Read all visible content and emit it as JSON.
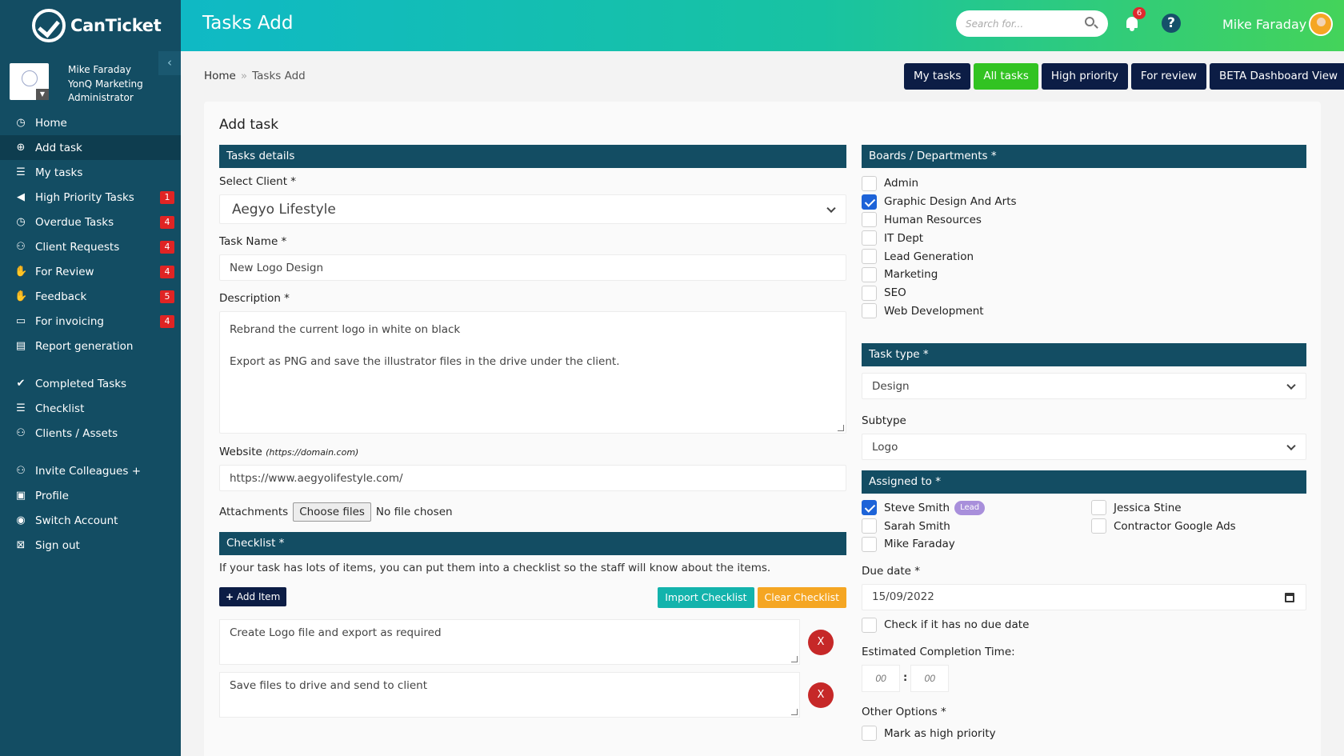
{
  "brand": {
    "name": "CanTicket"
  },
  "profile": {
    "name": "Mike Faraday",
    "company": "YonQ Marketing",
    "role": "Administrator"
  },
  "nav": [
    {
      "label": "Home",
      "icon": "clock-icon",
      "badge": ""
    },
    {
      "label": "Add task",
      "icon": "plus-circle-icon",
      "badge": "",
      "active": true
    },
    {
      "label": "My tasks",
      "icon": "list-icon",
      "badge": ""
    },
    {
      "label": "High Priority Tasks",
      "icon": "megaphone-icon",
      "badge": "1"
    },
    {
      "label": "Overdue Tasks",
      "icon": "clock-icon",
      "badge": "4"
    },
    {
      "label": "Client Requests",
      "icon": "users-icon",
      "badge": "4"
    },
    {
      "label": "For Review",
      "icon": "thumbs-up-icon",
      "badge": "4"
    },
    {
      "label": "Feedback",
      "icon": "thumbs-up-icon",
      "badge": "5"
    },
    {
      "label": "For invoicing",
      "icon": "credit-card-icon",
      "badge": "4"
    },
    {
      "label": "Report generation",
      "icon": "newspaper-icon",
      "badge": ""
    },
    {
      "label": "Completed Tasks",
      "icon": "check-circle-icon",
      "badge": ""
    },
    {
      "label": "Checklist",
      "icon": "list-icon",
      "badge": ""
    },
    {
      "label": "Clients / Assets",
      "icon": "users-icon",
      "badge": ""
    },
    {
      "label": "Invite Colleagues +",
      "icon": "users-icon",
      "badge": ""
    },
    {
      "label": "Profile",
      "icon": "id-card-icon",
      "badge": ""
    },
    {
      "label": "Switch Account",
      "icon": "toggle-icon",
      "badge": ""
    },
    {
      "label": "Sign out",
      "icon": "sign-out-icon",
      "badge": ""
    }
  ],
  "topbar": {
    "title": "Tasks Add",
    "search_placeholder": "Search for...",
    "notifications": "6",
    "help": "?",
    "user": "Mike Faraday"
  },
  "breadcrumb": {
    "home": "Home",
    "sep": "»",
    "current": "Tasks Add"
  },
  "quick_tabs": [
    "My tasks",
    "All tasks",
    "High priority",
    "For review",
    "BETA Dashboard View"
  ],
  "form": {
    "title": "Add task",
    "details_header": "Tasks details",
    "client_label": "Select Client *",
    "client_value": "Aegyo Lifestyle",
    "name_label": "Task Name *",
    "name_value": "New Logo Design",
    "desc_label": "Description *",
    "desc_line1": "Rebrand the current logo in white on black",
    "desc_line2": "Export as PNG and save the illustrator files in the drive under the client.",
    "website_label": "Website",
    "website_hint": "(https://domain.com)",
    "website_value": "https://www.aegyolifestyle.com/",
    "attach_label": "Attachments",
    "choose_files": "Choose files",
    "no_file": "No file chosen",
    "checklist_header": "Checklist *",
    "checklist_help": "If your task has lots of items, you can put them into a checklist so the staff will know about the items.",
    "add_item": "Add Item",
    "import_checklist": "Import Checklist",
    "clear_checklist": "Clear Checklist",
    "checklist_items": [
      "Create Logo file and export as required",
      "Save files to drive and send to client"
    ],
    "remove_label": "X"
  },
  "right": {
    "boards_header": "Boards / Departments *",
    "boards": [
      {
        "label": "Admin",
        "checked": false
      },
      {
        "label": "Graphic Design And Arts",
        "checked": true
      },
      {
        "label": "Human Resources",
        "checked": false
      },
      {
        "label": "IT Dept",
        "checked": false
      },
      {
        "label": "Lead Generation",
        "checked": false
      },
      {
        "label": "Marketing",
        "checked": false
      },
      {
        "label": "SEO",
        "checked": false
      },
      {
        "label": "Web Development",
        "checked": false
      }
    ],
    "task_type_header": "Task type *",
    "task_type_value": "Design",
    "subtype_label": "Subtype",
    "subtype_value": "Logo",
    "assigned_header": "Assigned to *",
    "assignees": [
      {
        "label": "Steve Smith",
        "checked": true,
        "tag": "Lead"
      },
      {
        "label": "Jessica Stine",
        "checked": false,
        "tag": ""
      },
      {
        "label": "Sarah Smith",
        "checked": false,
        "tag": ""
      },
      {
        "label": "Contractor Google Ads",
        "checked": false,
        "tag": ""
      },
      {
        "label": "Mike Faraday",
        "checked": false,
        "tag": ""
      }
    ],
    "due_label": "Due date *",
    "due_value": "15/09/2022",
    "no_due_label": "Check if it has no due date",
    "est_label": "Estimated Completion Time:",
    "est_hours": "00",
    "est_minutes": "00",
    "other_label": "Other Options *",
    "high_priority_label": "Mark as high priority"
  }
}
